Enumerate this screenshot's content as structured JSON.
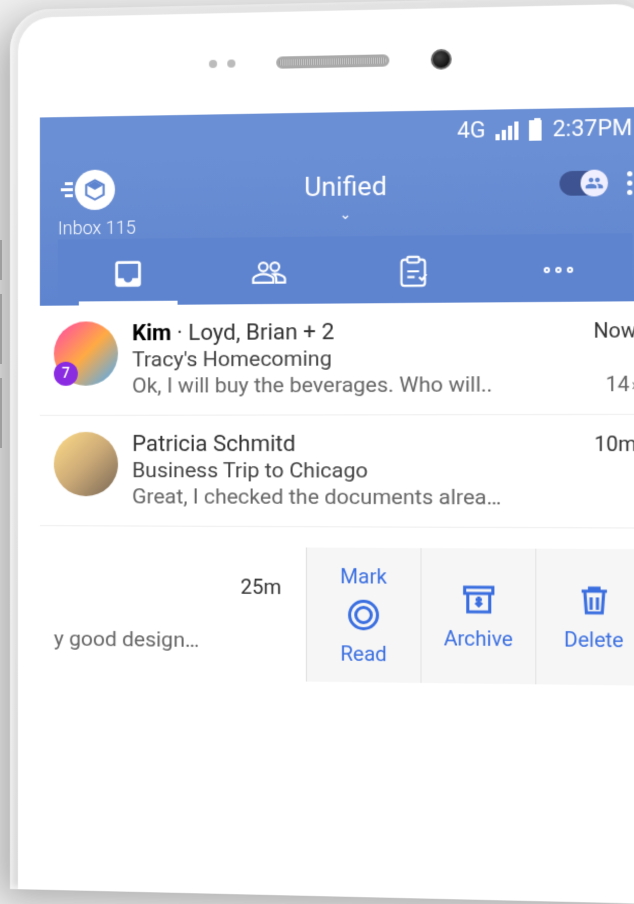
{
  "status": {
    "network": "4G",
    "time": "2:37PM"
  },
  "header": {
    "inbox_label": "Inbox 115",
    "title": "Unified"
  },
  "emails": [
    {
      "sender_bold": "Kim",
      "sender_rest": " · Loyd, Brian + 2",
      "time": "Now",
      "subject": "Tracy's Homecoming",
      "preview": "Ok, I will buy the beverages. Who will..",
      "badge": "7",
      "thread": "14"
    },
    {
      "sender_bold": "",
      "sender_rest": "Patricia Schmitd",
      "time": "10m",
      "subject": "Business Trip to Chicago",
      "preview": "Great, I checked the documents alrea…"
    }
  ],
  "row3": {
    "time": "25m",
    "preview": "y good design…"
  },
  "actions": {
    "mark_l1": "Mark",
    "mark_l2": "Read",
    "archive": "Archive",
    "delete": "Delete"
  }
}
